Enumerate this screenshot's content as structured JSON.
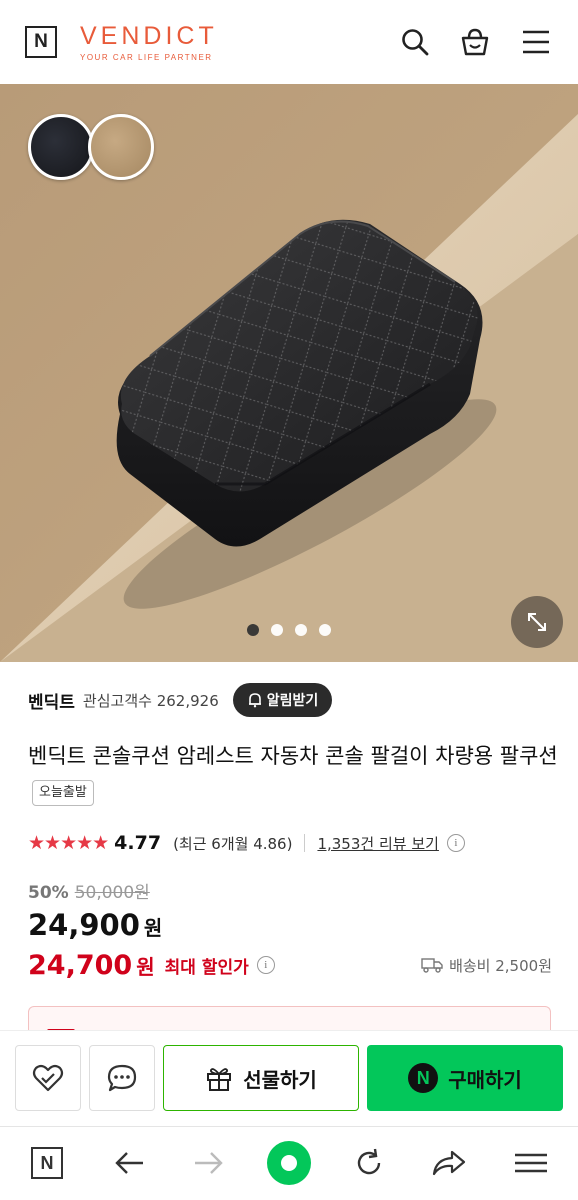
{
  "header": {
    "logo_letter": "N",
    "brand_name": "VENDICT",
    "brand_tagline": "YOUR CAR LIFE PARTNER",
    "search_icon": "search-icon",
    "cart_icon": "shopping-bag-icon",
    "menu_icon": "hamburger-menu-icon"
  },
  "gallery": {
    "color_options": [
      "black",
      "beige"
    ],
    "colors": {
      "black": "#1f1f22",
      "beige": "#b89a73",
      "background": "#c9b08f"
    },
    "slide_count": 4,
    "active_slide": 1,
    "expand_icon": "expand-icon"
  },
  "store": {
    "name": "벤딕트",
    "followers_label": "관심고객수",
    "followers_count": "262,926",
    "alert_label": "알림받기"
  },
  "product": {
    "title": "벤딕트 콘솔쿠션 암레스트 자동차 콘솔 팔걸이 차량용 팔쿠션",
    "badge": "오늘출발",
    "stars": "★★★★★",
    "rating": "4.77",
    "recent_rating": "(최근 6개월 4.86)",
    "review_link": "1,353건 리뷰 보기",
    "discount_rate": "50%",
    "original_price": "50,000원",
    "price": "24,900",
    "price_unit": "원",
    "max_discount_price": "24,700",
    "max_discount_unit": "원",
    "max_discount_label": "최대 할인가",
    "shipping": "배송비 2,500원"
  },
  "actions": {
    "gift_label": "선물하기",
    "buy_label": "구매하기",
    "npay_letter": "N"
  },
  "browser_nav": {
    "n_letter": "N"
  }
}
